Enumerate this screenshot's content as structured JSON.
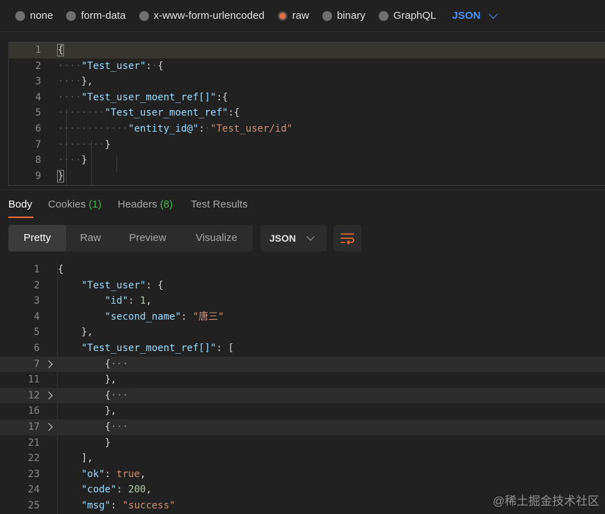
{
  "body_types": [
    {
      "label": "none",
      "selected": false
    },
    {
      "label": "form-data",
      "selected": false
    },
    {
      "label": "x-www-form-urlencoded",
      "selected": false
    },
    {
      "label": "raw",
      "selected": true
    },
    {
      "label": "binary",
      "selected": false
    },
    {
      "label": "GraphQL",
      "selected": false
    }
  ],
  "raw_format": "JSON",
  "editor_lines": [
    {
      "n": "1",
      "parts": [
        [
          "punc",
          "{"
        ]
      ]
    },
    {
      "n": "2",
      "parts": [
        [
          "ws",
          "····"
        ],
        [
          "key",
          "\"Test_user\""
        ],
        [
          "punc",
          ":"
        ],
        [
          "ws",
          "·"
        ],
        [
          "punc",
          "{"
        ]
      ]
    },
    {
      "n": "3",
      "parts": [
        [
          "ws",
          "····"
        ],
        [
          "punc",
          "},"
        ]
      ]
    },
    {
      "n": "4",
      "parts": [
        [
          "ws",
          "····"
        ],
        [
          "key",
          "\"Test_user_moent_ref[]\""
        ],
        [
          "punc",
          ":{"
        ]
      ]
    },
    {
      "n": "5",
      "parts": [
        [
          "ws",
          "········"
        ],
        [
          "key",
          "\"Test_user_moent_ref\""
        ],
        [
          "punc",
          ":{"
        ]
      ]
    },
    {
      "n": "6",
      "parts": [
        [
          "ws",
          "············"
        ],
        [
          "key",
          "\"entity_id@\""
        ],
        [
          "punc",
          ":"
        ],
        [
          "ws",
          "·"
        ],
        [
          "str",
          "\"Test_user/id\""
        ]
      ]
    },
    {
      "n": "7",
      "parts": [
        [
          "ws",
          "········"
        ],
        [
          "punc",
          "}"
        ]
      ]
    },
    {
      "n": "8",
      "parts": [
        [
          "ws",
          "····"
        ],
        [
          "punc",
          "}"
        ]
      ]
    },
    {
      "n": "9",
      "parts": [
        [
          "punc",
          "}"
        ]
      ]
    }
  ],
  "response_tabs": [
    {
      "label": "Body",
      "count": "",
      "active": true
    },
    {
      "label": "Cookies",
      "count": "(1)",
      "active": false
    },
    {
      "label": "Headers",
      "count": "(8)",
      "active": false
    },
    {
      "label": "Test Results",
      "count": "",
      "active": false
    }
  ],
  "view_modes": [
    {
      "label": "Pretty",
      "active": true
    },
    {
      "label": "Raw",
      "active": false
    },
    {
      "label": "Preview",
      "active": false
    },
    {
      "label": "Visualize",
      "active": false
    }
  ],
  "response_format": "JSON",
  "response_lines": [
    {
      "n": "1",
      "fold": false,
      "parts": [
        [
          "punc",
          "{"
        ]
      ]
    },
    {
      "n": "2",
      "fold": false,
      "parts": [
        [
          "sp",
          "    "
        ],
        [
          "key",
          "\"Test_user\""
        ],
        [
          "punc",
          ": {"
        ]
      ]
    },
    {
      "n": "3",
      "fold": false,
      "parts": [
        [
          "sp",
          "        "
        ],
        [
          "key",
          "\"id\""
        ],
        [
          "punc",
          ": "
        ],
        [
          "num",
          "1"
        ],
        [
          "punc",
          ","
        ]
      ]
    },
    {
      "n": "4",
      "fold": false,
      "parts": [
        [
          "sp",
          "        "
        ],
        [
          "key",
          "\"second_name\""
        ],
        [
          "punc",
          ": "
        ],
        [
          "str",
          "\"唐三\""
        ]
      ]
    },
    {
      "n": "5",
      "fold": false,
      "parts": [
        [
          "sp",
          "    "
        ],
        [
          "punc",
          "},"
        ]
      ]
    },
    {
      "n": "6",
      "fold": false,
      "parts": [
        [
          "sp",
          "    "
        ],
        [
          "key",
          "\"Test_user_moent_ref[]\""
        ],
        [
          "punc",
          ": ["
        ]
      ]
    },
    {
      "n": "7",
      "fold": true,
      "parts": [
        [
          "sp",
          "        "
        ],
        [
          "punc",
          "{"
        ],
        [
          "ellipsis",
          "···"
        ]
      ]
    },
    {
      "n": "11",
      "fold": false,
      "parts": [
        [
          "sp",
          "        "
        ],
        [
          "punc",
          "},"
        ]
      ]
    },
    {
      "n": "12",
      "fold": true,
      "parts": [
        [
          "sp",
          "        "
        ],
        [
          "punc",
          "{"
        ],
        [
          "ellipsis",
          "···"
        ]
      ]
    },
    {
      "n": "16",
      "fold": false,
      "parts": [
        [
          "sp",
          "        "
        ],
        [
          "punc",
          "},"
        ]
      ]
    },
    {
      "n": "17",
      "fold": true,
      "parts": [
        [
          "sp",
          "        "
        ],
        [
          "punc",
          "{"
        ],
        [
          "ellipsis",
          "···"
        ]
      ]
    },
    {
      "n": "21",
      "fold": false,
      "parts": [
        [
          "sp",
          "        "
        ],
        [
          "punc",
          "}"
        ]
      ]
    },
    {
      "n": "22",
      "fold": false,
      "parts": [
        [
          "sp",
          "    "
        ],
        [
          "punc",
          "],"
        ]
      ]
    },
    {
      "n": "23",
      "fold": false,
      "parts": [
        [
          "sp",
          "    "
        ],
        [
          "key",
          "\"ok\""
        ],
        [
          "punc",
          ": "
        ],
        [
          "kw",
          "true"
        ],
        [
          "punc",
          ","
        ]
      ]
    },
    {
      "n": "24",
      "fold": false,
      "parts": [
        [
          "sp",
          "    "
        ],
        [
          "key",
          "\"code\""
        ],
        [
          "punc",
          ": "
        ],
        [
          "num",
          "200"
        ],
        [
          "punc",
          ","
        ]
      ]
    },
    {
      "n": "25",
      "fold": false,
      "parts": [
        [
          "sp",
          "    "
        ],
        [
          "key",
          "\"msg\""
        ],
        [
          "punc",
          ": "
        ],
        [
          "str",
          "\"success\""
        ]
      ]
    }
  ],
  "watermark": "@稀土掘金技术社区",
  "colors": {
    "accent": "#ff6c37",
    "json_link": "#4b8ff0",
    "count_green": "#3fb950",
    "key": "#9cdcfe",
    "string": "#ce9178",
    "number": "#b5cea8"
  }
}
